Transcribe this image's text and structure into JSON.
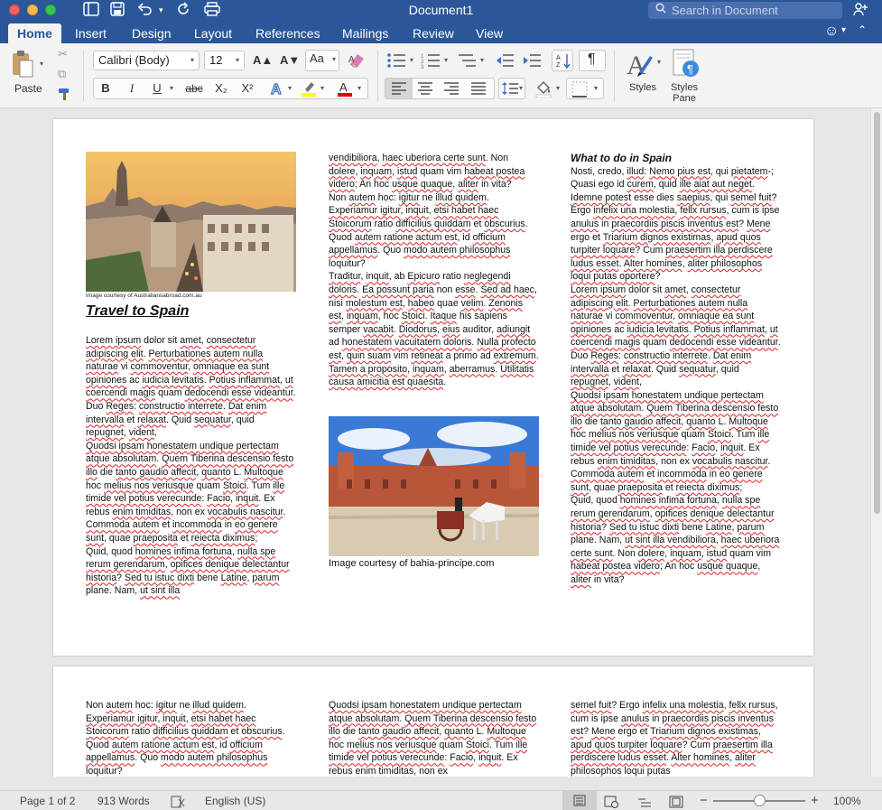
{
  "window": {
    "title": "Document1"
  },
  "search": {
    "placeholder": "Search in Document"
  },
  "tabs": [
    "Home",
    "Insert",
    "Design",
    "Layout",
    "References",
    "Mailings",
    "Review",
    "View"
  ],
  "ribbon": {
    "paste_label": "Paste",
    "font_name": "Calibri (Body)",
    "font_size": "12",
    "styles_label": "Styles",
    "styles_pane_label1": "Styles",
    "styles_pane_label2": "Pane",
    "bold": "B",
    "italic": "I",
    "underline": "U",
    "strike": "abc",
    "subscript": "X₂",
    "superscript": "X²",
    "grow_font": "A▲",
    "shrink_font": "A▼",
    "change_case": "Aa",
    "pilcrow": "¶",
    "highlight_color": "#ffff00",
    "font_color": "#e00000"
  },
  "page1": {
    "image1_credit": "Image courtesy of Australiansabroad.com.au",
    "title": "Travel to Spain",
    "col1_text": "<p><span class='sq'>Lorem ipsum</span> dolor sit <span class='sq'>amet</span>, <span class='sq'>consectetur adipiscing elit</span>. <span class='sq'>Perturbationes autem nulla naturae</span> vi <span class='sq'>commoventur</span>, <span class='sq'>omniaque ea sunt opiniones</span> ac <span class='sq'>iudicia levitatis</span>. <span class='sq'>Potius inflammat</span>, <span class='sq'>ut coercendi magis</span> quam <span class='sq'>dedocendi esse videantur</span>. Duo <span class='sq'>Reges</span>: <span class='sq'>constructio interrete</span>. <span class='sq'>Dat enim intervalla</span> et <span class='sq'>relaxat</span>. Quid <span class='sq'>sequatur</span>, quid <span class='sq'>repugnet</span>, <span class='sq'>vident</span>,</p><p><span class='sq'>Quodsi ipsam honestatem undique pertectam atque absolutam</span>. <span class='sq'>Quem Tiberina descensio festo illo</span> die <span class='sq'>tanto gaudio affecit</span>, <span class='sq'>quanto</span> L. <span class='sq'>Multoque</span> hoc <span class='sq'>melius nos veriusque</span> quam <span class='sq'>Stoici</span>. Tum <span class='sq'>ille timide vel potius verecunde</span>: <span class='sq'>Facio</span>, <span class='sq'>inquit</span>. Ex rebus <span class='sq'>enim timiditas</span>, non ex <span class='sq'>vocabulis nascitur</span>. <span class='sq'>Commoda autem</span> et <span class='sq'>incommoda</span> in <span class='sq'>eo genere sunt</span>, quae <span class='sq'>praeposita</span> et <span class='sq'>reiecta diximus</span>;</p><p>Quid, quod <span class='sq'>homines infima fortuna</span>, <span class='sq'>nulla spe rerum gerendarum</span>, <span class='sq'>opifices denique delectantur historia</span>? <span class='sq'>Sed tu istuc dixti</span> bene <span class='sq'>Latine</span>, <span class='sq'>parum</span> plane. Nam, <span class='sq'>ut sint illa</span></p>",
    "col2_text": "<p><span class='sq'>vendibiliora</span>, <span class='sq'>haec uberiora certe sunt</span>. Non <span class='sq'>dolere</span>, <span class='sq'>inquam</span>, <span class='sq'>istud</span> quam vim <span class='sq'>habeat postea videro</span>; An hoc <span class='sq'>usque quaque</span>, <span class='sq'>aliter</span> in vita?</p><p>Non <span class='sq'>autem</span> hoc: <span class='sq'>igitur</span> ne <span class='sq'>illud quidem</span>. <span class='sq'>Experiamur igitur</span>, <span class='sq'>inquit</span>, <span class='sq'>etsi habet haec Stoicorum</span> ratio <span class='sq'>difficilius quiddam</span> et <span class='sq'>obscurius</span>. Quod <span class='sq'>autem ratione actum est</span>, id <span class='sq'>officium appellamus</span>. Quo <span class='sq'>modo autem philosophus</span> loquitur?</p><p><span class='sq'>Traditur</span>, <span class='sq'>inquit</span>, ab <span class='sq'>Epicuro</span> ratio <span class='sq'>neglegendi doloris</span>. <span class='sq'>Ea possunt paria</span> non <span class='sq'>esse</span>. <span class='sq'>Sed ad haec</span>, nisi <span class='sq'>molestum est</span>, <span class='sq'>habeo</span> quae <span class='sq'>velim</span>. <span class='sq'>Zenonis est</span>, <span class='sq'>inquam</span>, hoc <span class='sq'>Stoici</span>. <span class='sq'>Itaque</span> his sapiens semper <span class='sq'>vacabit</span>. <span class='sq'>Diodorus</span>, <span class='sq'>eius</span> auditor, <span class='sq'>adiungit</span> ad <span class='sq'>honestatem vacuitatem doloris</span>. <span class='sq'>Nulla profecto est</span>, <span class='sq'>quin suam</span> vim <span class='sq'>retineat</span> a primo ad <span class='sq'>extremum</span>. <span class='sq'>Tamen a proposito</span>, <span class='sq'>inquam</span>, <span class='sq'>aberramus</span>. <span class='sq'>Utilitatis causa amicitia est quaesita</span>.</p>",
    "image2_credit": "Image courtesy of bahia-principe.com",
    "col3_heading": "What to do in Spain",
    "col3_text": "<p>Nosti, credo, <span class='sq'>illud</span>: <span class='sq'>Nemo pius est</span>, qui <span class='sq'>pietatem</span>-; Quasi ego id <span class='sq'>curem</span>, quid <span class='sq'>ille aiat aut neget</span>. <span class='sq'>Idemne potest</span> esse dies <span class='sq'>saepius</span>, qui <span class='sq'>semel fuit</span>? Ergo <span class='sq'>infelix una molestia</span>, <span class='sq'>fellx rursus</span>, cum is ipse <span class='sq'>anulus</span> in <span class='sq'>praecordiis piscis inventus est</span>? <span class='sq'>Mene</span> ergo et <span class='sq'>Triarium dignos existimas</span>, <span class='sq'>apud quos turpiter loquare</span>? Cum <span class='sq'>praesertim illa perdiscere ludus esset</span>. <span class='sq'>Alter homines</span>, <span class='sq'>aliter philosophos loqui putas oportere</span>?</p><p><span class='sq'>Lorem ipsum</span> dolor sit <span class='sq'>amet</span>, <span class='sq'>consectetur adipiscing elit</span>. <span class='sq'>Perturbationes autem nulla naturae</span> vi <span class='sq'>commoventur</span>, <span class='sq'>omniaque ea sunt opiniones</span> ac <span class='sq'>iudicia levitatis</span>. <span class='sq'>Potius inflammat</span>, <span class='sq'>ut coercendi magis</span> quam <span class='sq'>dedocendi esse videantur</span>. Duo <span class='sq'>Reges</span>: <span class='sq'>constructio interrete</span>. <span class='sq'>Dat enim intervalla</span> et <span class='sq'>relaxat</span>. Quid <span class='sq'>sequatur</span>, quid <span class='sq'>repugnet</span>, <span class='sq'>vident</span>,</p><p><span class='sq'>Quodsi ipsam honestatem undique pertectam atque absolutam</span>. <span class='sq'>Quem Tiberina descensio festo illo</span> die <span class='sq'>tanto gaudio affecit</span>, <span class='sq'>quanto</span> L. <span class='sq'>Multoque</span> hoc <span class='sq'>melius nos veriusque</span> quam <span class='sq'>Stoici</span>. Tum <span class='sq'>ille timide vel potius verecunde</span>: <span class='sq'>Facio</span>, <span class='sq'>inquit</span>. Ex rebus <span class='sq'>enim timiditas</span>, non ex <span class='sq'>vocabulis nascitur</span>. <span class='sq'>Commoda autem</span> et <span class='sq'>incommoda</span> in <span class='sq'>eo genere sunt</span>, quae <span class='sq'>praeposita</span> et <span class='sq'>reiecta diximus</span>;</p><p>Quid, quod <span class='sq'>homines infima fortuna</span>, <span class='sq'>nulla spe rerum gerendarum</span>, <span class='sq'>opifices denique delectantur historia</span>? <span class='sq'>Sed tu istuc dixti</span> bene <span class='sq'>Latine</span>, <span class='sq'>parum</span> plane. Nam, <span class='sq'>ut sint illa vendibiliora</span>, <span class='sq'>haec uberiora certe sunt</span>. Non <span class='sq'>dolere</span>, <span class='sq'>inquam</span>, <span class='sq'>istud</span> quam vim <span class='sq'>habeat postea videro</span>; An hoc <span class='sq'>usque quaque</span>, <span class='sq'>aliter</span> in vita?</p>"
  },
  "page2": {
    "col1_text": "<p>Non <span class='sq'>autem</span> hoc: <span class='sq'>igitur</span> ne <span class='sq'>illud quidem</span>. <span class='sq'>Experiamur igitur</span>, <span class='sq'>inquit</span>, <span class='sq'>etsi habet haec Stoicorum</span> ratio <span class='sq'>difficilius quiddam</span> et <span class='sq'>obscurius</span>. Quod <span class='sq'>autem ratione actum est</span>, id <span class='sq'>officium appellamus</span>. Quo <span class='sq'>modo autem philosophus</span> loquitur?</p>",
    "col2_text": "<p><span class='sq'>Quodsi ipsam honestatem undique pertectam atque absolutam</span>. <span class='sq'>Quem Tiberina descensio festo illo</span> die <span class='sq'>tanto gaudio affecit</span>, <span class='sq'>quanto</span> L. <span class='sq'>Multoque</span> hoc <span class='sq'>melius nos veriusque</span> quam <span class='sq'>Stoici</span>. Tum <span class='sq'>ille timide vel potius verecunde</span>: <span class='sq'>Facio</span>, <span class='sq'>inquit</span>. Ex rebus <span class='sq'>enim timiditas</span>, non ex</p>",
    "col3_text": "<p><span class='sq'>semel fuit</span>? Ergo <span class='sq'>infelix una molestia</span>, <span class='sq'>fellx rursus</span>, cum is ipse <span class='sq'>anulus</span> in <span class='sq'>praecordiis piscis inventus est</span>? <span class='sq'>Mene</span> ergo et <span class='sq'>Triarium dignos existimas</span>, <span class='sq'>apud quos turpiter loquare</span>? Cum <span class='sq'>praesertim illa perdiscere ludus esset</span>. <span class='sq'>Alter homines</span>, <span class='sq'>aliter philosophos loqui putas</span></p>"
  },
  "status": {
    "page": "Page 1 of 2",
    "words": "913 Words",
    "language": "English (US)",
    "zoom_minus": "−",
    "zoom_plus": "+",
    "zoom": "100%",
    "zoom_level": 0.5
  }
}
